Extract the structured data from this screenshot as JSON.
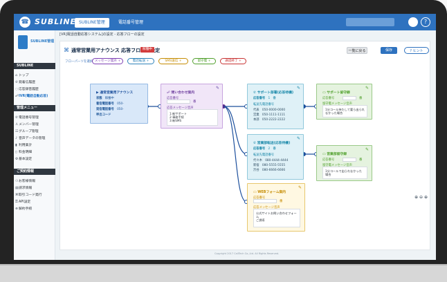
{
  "app": {
    "brand": "SUBLINE",
    "tabs": [
      {
        "label": "SUBLINE管理"
      },
      {
        "label": "電話番号管理"
      }
    ],
    "crumb": "[VR]電話自動応答システム]の設定 - 応答フローの設定"
  },
  "sidebar": {
    "logo_label": "SUBLINE管理",
    "sections": [
      {
        "title": "SUBLINE"
      },
      {
        "title": "管理メニュー"
      },
      {
        "title": "ご契約情報"
      }
    ],
    "items": [
      {
        "label": "トップ",
        "icon": "home-icon"
      },
      {
        "label": "発着信履歴",
        "icon": "phone-icon"
      },
      {
        "label": "応答録音履歴",
        "icon": "record-icon"
      },
      {
        "label": "IVR(電話自動応答)",
        "icon": "ivr-icon"
      },
      {
        "label": "電話番号管理",
        "icon": "phone-icon"
      },
      {
        "label": "メンバー管理",
        "icon": "member-icon"
      },
      {
        "label": "グループ管理",
        "icon": "group-icon"
      },
      {
        "label": "音声データの管理",
        "icon": "audio-icon"
      },
      {
        "label": "利用集計",
        "icon": "chart-icon"
      },
      {
        "label": "料金明細",
        "icon": "bill-icon"
      },
      {
        "label": "基本設定",
        "icon": "gear-icon"
      },
      {
        "label": "お客様情報",
        "icon": "user-icon"
      },
      {
        "label": "請求情報",
        "icon": "invoice-icon"
      },
      {
        "label": "取引コード発行",
        "icon": "code-icon"
      },
      {
        "label": "API設定",
        "icon": "api-icon"
      },
      {
        "label": "解約手続",
        "icon": "cancel-icon"
      }
    ]
  },
  "page": {
    "title": "通常営業用アナウンス 応答フローの設定",
    "badge": "稼働中",
    "buttons": {
      "list": "一覧に戻る",
      "save": "保存",
      "hint": "ヒント"
    },
    "flow_label": "フローパーツを選択",
    "chips": [
      {
        "label": "メッセージ発声 +",
        "color": "#7d3fb4"
      },
      {
        "label": "電話転送 +",
        "color": "#2d82b9"
      },
      {
        "label": "SMS送信 +",
        "color": "#c58b00"
      },
      {
        "label": "留守電 +",
        "color": "#4f9f2b"
      },
      {
        "label": "通話終了 +",
        "color": "#c83232"
      }
    ],
    "nodes": {
      "start": {
        "title": "通常営業用アナウンス",
        "status_label": "状態",
        "status": "稼働中",
        "phone_label": "着信電話番号",
        "phone": "050-",
        "sender_label": "発信電話番号",
        "sender": "050-",
        "code_label": "呼出コード"
      },
      "menu": {
        "title": "問い合わせ案内",
        "number_label": "応答番号",
        "unit": "番",
        "msg_label": "応答メッセージ音声",
        "msg": "1:新サポート\n2:事務手続\n3:新SMS"
      },
      "support": {
        "title": "サポート部署(応答待機)",
        "number_label": "応答番号",
        "number": "1",
        "unit": "番",
        "transfer_label": "転送先電話番号",
        "rows": [
          {
            "k": "代表",
            "v": "050-0000-0000"
          },
          {
            "k": "営業",
            "v": "050-1111-1111"
          },
          {
            "k": "本部",
            "v": "050-2222-2222"
          }
        ]
      },
      "support_vm": {
        "title": "サポート留守録",
        "number_label": "応答番号",
        "unit": "番",
        "msg_label": "留守電メッセージ音声",
        "msg": "1分コール待たして要ら出られなかった場合"
      },
      "sales": {
        "title": "営業部転送(応答待機)",
        "number_label": "応答番号",
        "number": "2",
        "unit": "番",
        "transfer_label": "転送先電話番号",
        "rows": [
          {
            "k": "代々木",
            "v": "080-4444-4444"
          },
          {
            "k": "新宿",
            "v": "080-5555-5555"
          },
          {
            "k": "渋谷",
            "v": "080-6666-6666"
          }
        ]
      },
      "sales_vm": {
        "title": "営業部留守録",
        "number_label": "応答番号",
        "unit": "番",
        "msg_label": "留守電メッセージ音声",
        "msg": "1分コールで出られなかった場合"
      },
      "web": {
        "title": "WEBフォーム案内",
        "number_label": "応答番号",
        "unit": "番",
        "msg_label": "応答メッセージ音声",
        "msg": "公式サイトお問い合わせフォーム\nご誘導"
      }
    },
    "zoom": "⊕ ⊖ ⊕",
    "footer": "Copyright 2017 CallTech Co.,Ltd. All Rights Reserved."
  }
}
